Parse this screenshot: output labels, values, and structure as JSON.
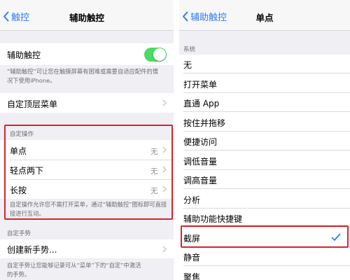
{
  "left": {
    "nav": {
      "back_label": "触控",
      "title": "辅助触控"
    },
    "assistive_touch": {
      "label": "辅助触控",
      "toggle_on": true
    },
    "assistive_desc": [
      "“辅助触控”可让您在触摸屏幕有困难或需要自适应配件的情",
      "况下使用iPhone。"
    ],
    "custom_top_menu": {
      "label": "自定顶层菜单"
    },
    "custom_actions": {
      "header": "自定操作",
      "rows": [
        {
          "label": "单点",
          "value": "无"
        },
        {
          "label": "轻点两下",
          "value": "无"
        },
        {
          "label": "长按",
          "value": "无"
        }
      ],
      "desc": [
        "自定操作允许您不需打开菜单，通过“辅助触控”图标即可直接",
        "接进行互动。"
      ]
    },
    "custom_gestures": {
      "header": "自定手势",
      "create_label": "创建新手势...",
      "desc": [
        "自定手势让您能够记录可从“菜单”下的“自定”中激活",
        "的手势。"
      ]
    }
  },
  "right": {
    "nav": {
      "back_label": "辅助触控",
      "title": "单点"
    },
    "section_header": "系统",
    "items": [
      {
        "label": "无"
      },
      {
        "label": "打开菜单"
      },
      {
        "label": "直通 App"
      },
      {
        "label": "按住并拖移"
      },
      {
        "label": "便捷访问"
      },
      {
        "label": "调低音量"
      },
      {
        "label": "调高音量"
      },
      {
        "label": "分析"
      },
      {
        "label": "辅助功能快捷键"
      },
      {
        "label": "截屏"
      },
      {
        "label": "静音"
      },
      {
        "label": "聚焦"
      }
    ],
    "selected_index": 9
  },
  "colors": {
    "accent": "#2f7cf6",
    "toggle_on": "#4cd964",
    "highlight_box": "#d5262c",
    "background": "#efeff4"
  }
}
